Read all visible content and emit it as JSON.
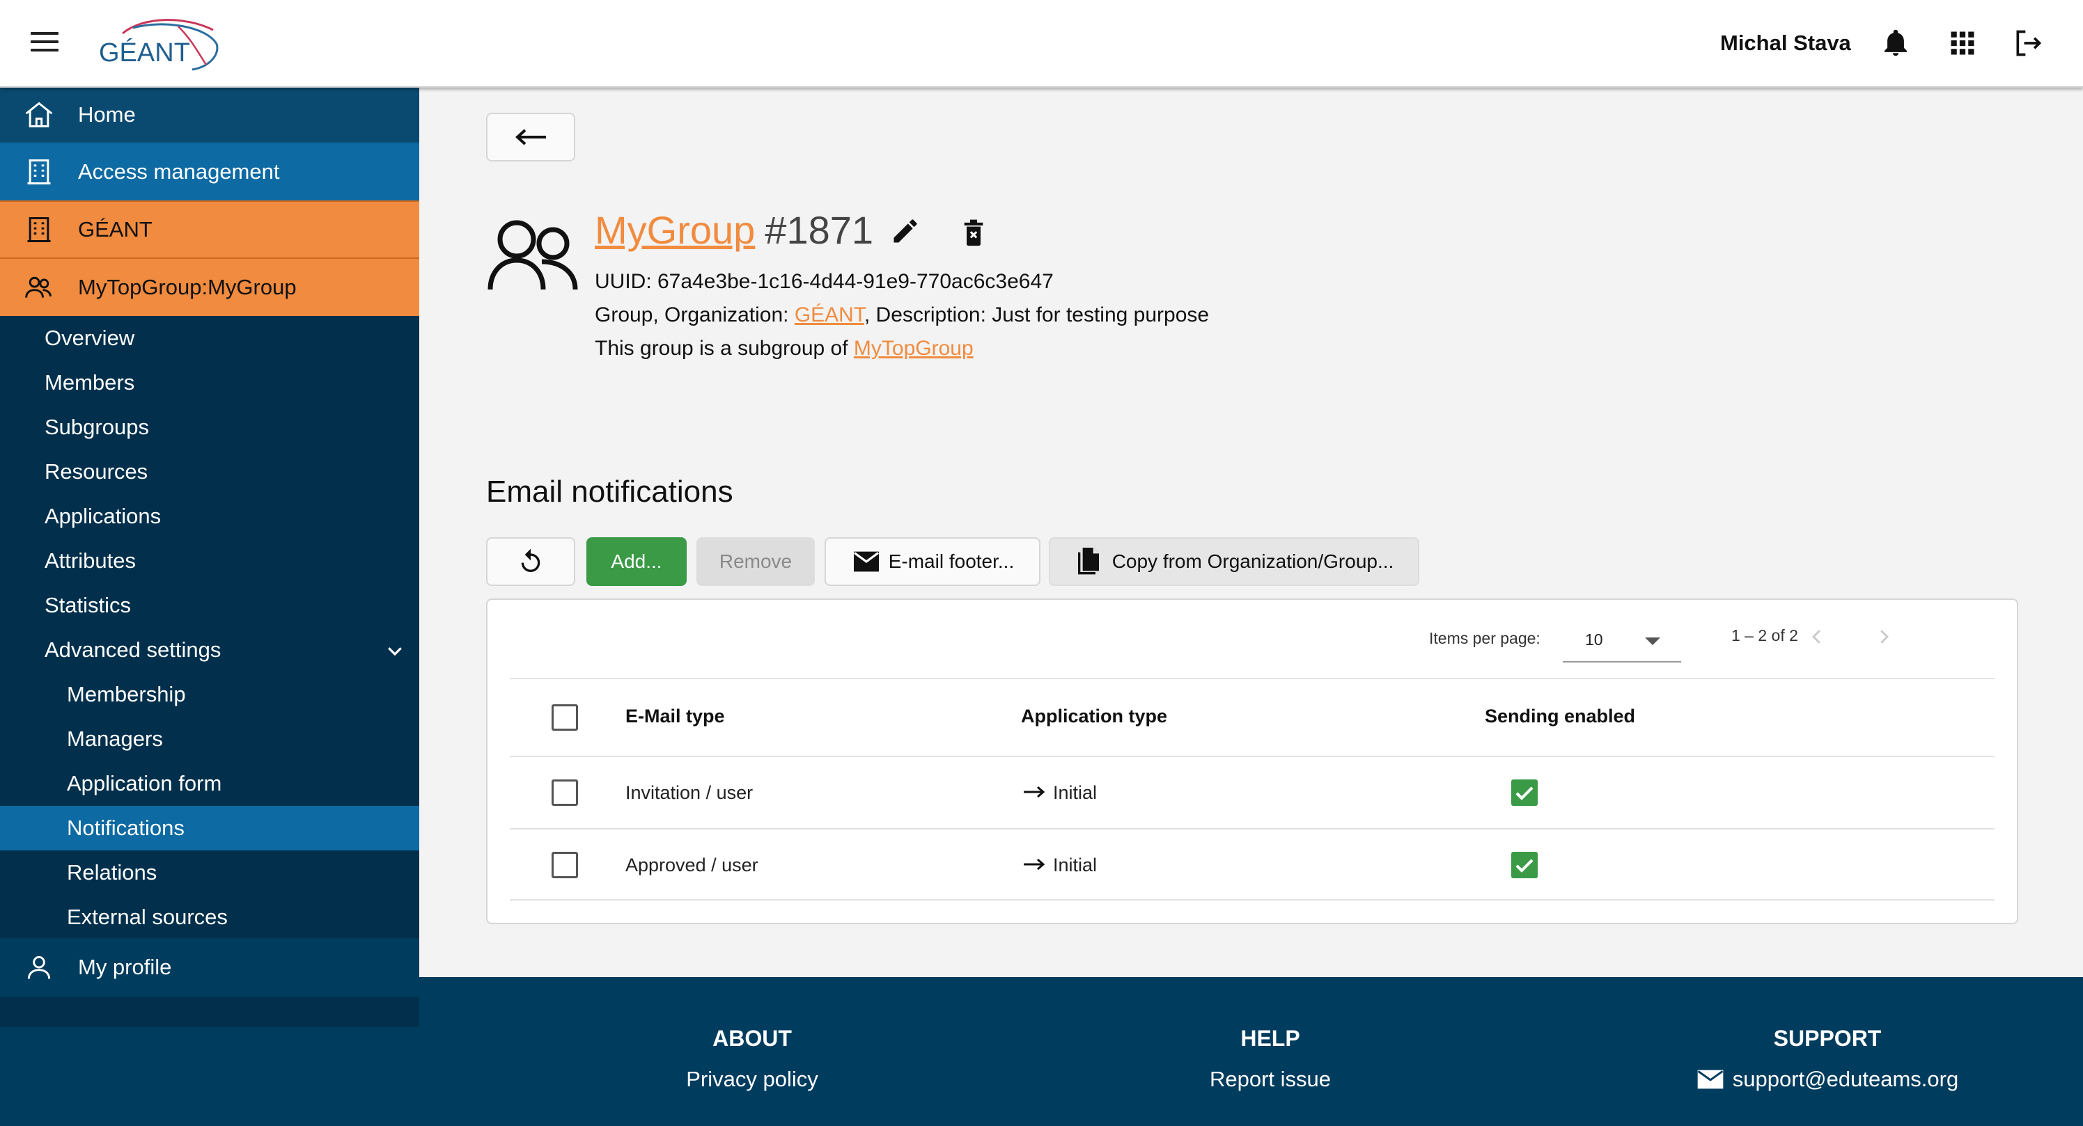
{
  "header": {
    "logo_text": "GÉANT",
    "user_name": "Michal Stava",
    "icons": [
      "menu-icon",
      "bell-icon",
      "apps-grid-icon",
      "logout-icon"
    ]
  },
  "sidebar": {
    "home": "Home",
    "access_management": "Access management",
    "organization": "GÉANT",
    "group": "MyTopGroup:MyGroup",
    "group_items": [
      "Overview",
      "Members",
      "Subgroups",
      "Resources",
      "Applications",
      "Attributes",
      "Statistics",
      "Advanced settings"
    ],
    "advanced_items": [
      "Membership",
      "Managers",
      "Application form",
      "Notifications",
      "Relations",
      "External sources"
    ],
    "active_item": "Notifications",
    "my_profile": "My profile"
  },
  "group": {
    "name": "MyGroup",
    "id": "#1871",
    "uuid_line": "UUID: 67a4e3be-1c16-4d44-91e9-770ac6c3e647",
    "type_prefix": "Group, Organization: ",
    "organization": "GÉANT",
    "description": ", Description: Just for testing purpose",
    "subgroup_prefix": "This group is a subgroup of ",
    "parent": "MyTopGroup"
  },
  "notifications": {
    "title": "Email notifications",
    "buttons": {
      "add": "Add...",
      "remove": "Remove",
      "footer": "E-mail footer...",
      "copy": "Copy from Organization/Group..."
    },
    "paginator": {
      "items_per_page_label": "Items per page:",
      "items_per_page": "10",
      "range": "1 – 2 of 2"
    },
    "columns": [
      "E-Mail type",
      "Application type",
      "Sending enabled"
    ],
    "rows": [
      {
        "email_type": "Invitation / user",
        "app_type": "Initial",
        "sending_enabled": true
      },
      {
        "email_type": "Approved / user",
        "app_type": "Initial",
        "sending_enabled": true
      }
    ]
  },
  "footer": {
    "about_title": "ABOUT",
    "about_link": "Privacy policy",
    "help_title": "HELP",
    "help_link": "Report issue",
    "support_title": "SUPPORT",
    "support_link": "support@eduteams.org"
  },
  "colors": {
    "brand_orange": "#f08b3f",
    "sidebar_dark": "#003c5e",
    "sidebar_active": "#0d6aa3",
    "success_green": "#3a9a45"
  }
}
